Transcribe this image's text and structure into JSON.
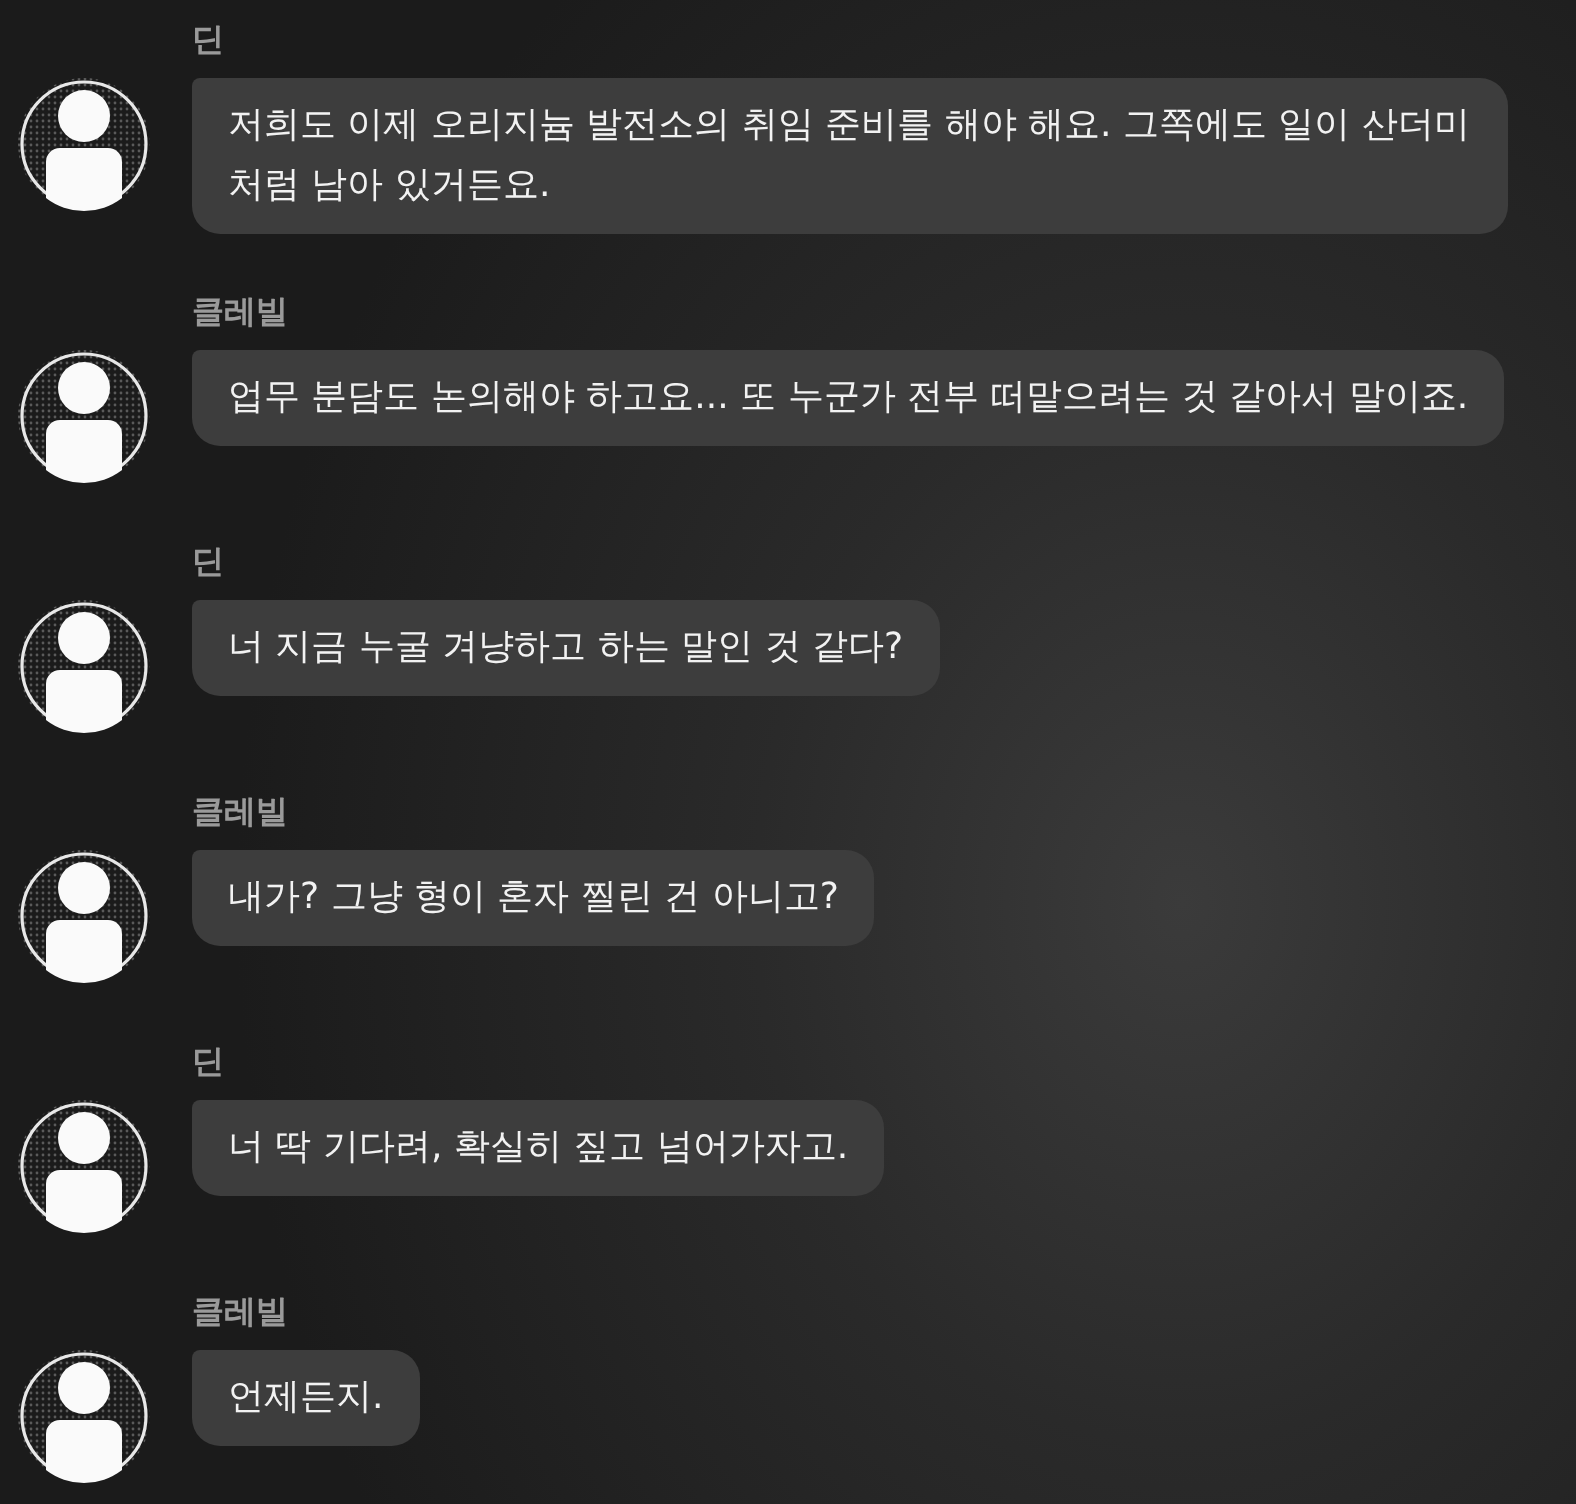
{
  "messages": [
    {
      "sender": "딘",
      "text": "저희도 이제 오리지늄 발전소의 취임 준비를 해야 해요. 그쪽에도 일이 산더미처럼 남아 있거든요."
    },
    {
      "sender": "클레빌",
      "text": "업무 분담도 논의해야 하고요... 또 누군가 전부 떠맡으려는 것 같아서 말이죠."
    },
    {
      "sender": "딘",
      "text": "너 지금 누굴 겨냥하고 하는 말인 것 같다?"
    },
    {
      "sender": "클레빌",
      "text": "내가? 그냥 형이 혼자 찔린 건 아니고?"
    },
    {
      "sender": "딘",
      "text": "너 딱 기다려, 확실히 짚고 넘어가자고."
    },
    {
      "sender": "클레빌",
      "text": "언제든지."
    }
  ]
}
